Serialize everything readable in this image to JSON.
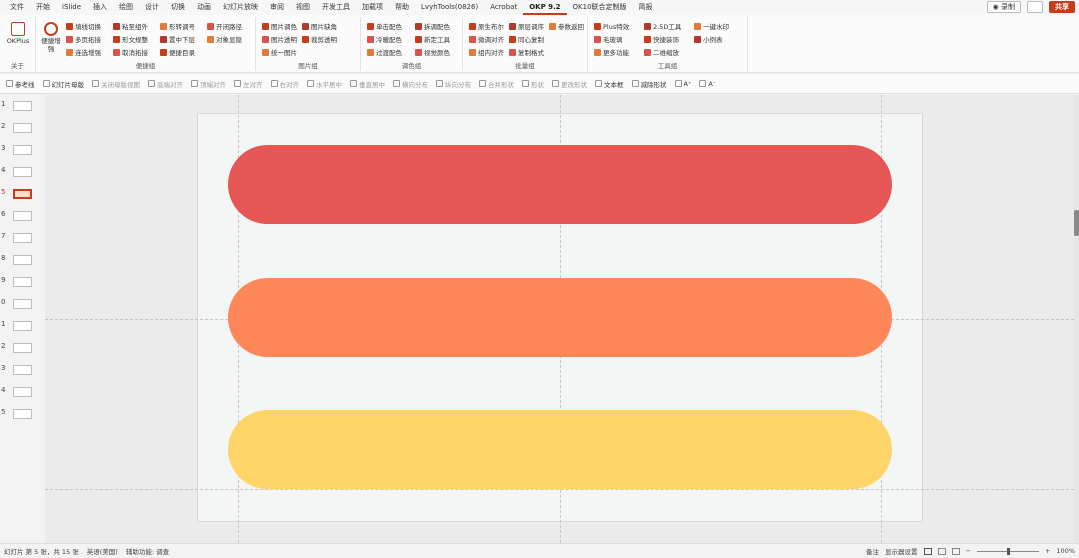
{
  "menubar": {
    "tabs": [
      "文件",
      "开始",
      "iSlide",
      "插入",
      "绘图",
      "设计",
      "切换",
      "动画",
      "幻灯片放映",
      "审阅",
      "视图",
      "开发工具",
      "加载项",
      "帮助",
      "LvyhTools(0826)",
      "Acrobat",
      "OKP 9.2",
      "OK10联合定制版",
      "简报"
    ],
    "active": "OKP 9.2",
    "record": "◉ 录制",
    "share": "共享"
  },
  "ribbon": {
    "okplus": {
      "label": "OKPlus",
      "group": "关于"
    },
    "convenience": {
      "group": "便捷组",
      "big": "便捷增强",
      "items": [
        "填线切换",
        "多页拓接",
        "连选增强",
        "粘至组外",
        "形文规整",
        "取消拓接",
        "形转调号",
        "置中下层",
        "便捷目录",
        "开闭路径",
        "对象显隐"
      ]
    },
    "image": {
      "group": "图片组",
      "items": [
        "图片调色",
        "图片透明",
        "统一图片",
        "图片缺角",
        "裁剪透明"
      ]
    },
    "color": {
      "group": "调色组",
      "items": [
        "单击配色",
        "冷暖配色",
        "过渡配色",
        "拆调配色",
        "新定工具",
        "视觉颜色"
      ]
    },
    "batch": {
      "group": "批量组",
      "items": [
        "原生布尔",
        "微调对齐",
        "组内对齐",
        "原层调序",
        "同心复制",
        "复制格式",
        "参数返回"
      ]
    },
    "tools": {
      "group": "工具组",
      "items": [
        "Plus特效",
        "毛玻璃",
        "更多功能",
        "2.5D工具",
        "快捷装饰",
        "二维缩放",
        "一键水印",
        "小例表"
      ]
    }
  },
  "toolbar2": {
    "items": [
      "参考线",
      "幻灯片母版",
      "关闭母版视图",
      "底端对齐",
      "顶端对齐",
      "左对齐",
      "右对齐",
      "水平居中",
      "垂直居中",
      "横向分布",
      "纵向分布",
      "合并形状",
      "形状",
      "更改形状",
      "文本框",
      "减除形状",
      "A⁺",
      "A⁻"
    ]
  },
  "slides": {
    "numbers": [
      "1",
      "2",
      "3",
      "4",
      "5",
      "6",
      "7",
      "8",
      "9",
      "0",
      "1",
      "2",
      "3",
      "4",
      "5"
    ],
    "selected_index": 4
  },
  "canvas": {
    "bars": [
      {
        "name": "red",
        "color": "#e55655"
      },
      {
        "name": "orange",
        "color": "#fd8759"
      },
      {
        "name": "yellow",
        "color": "#ffd56a"
      }
    ]
  },
  "status": {
    "slide_info": "幻灯片 第 5 张，共 15 张",
    "language": "英语(美国)",
    "accessibility": "辅助功能: 调查",
    "notes": "备注",
    "display": "显示器设置",
    "zoom": "100%"
  }
}
